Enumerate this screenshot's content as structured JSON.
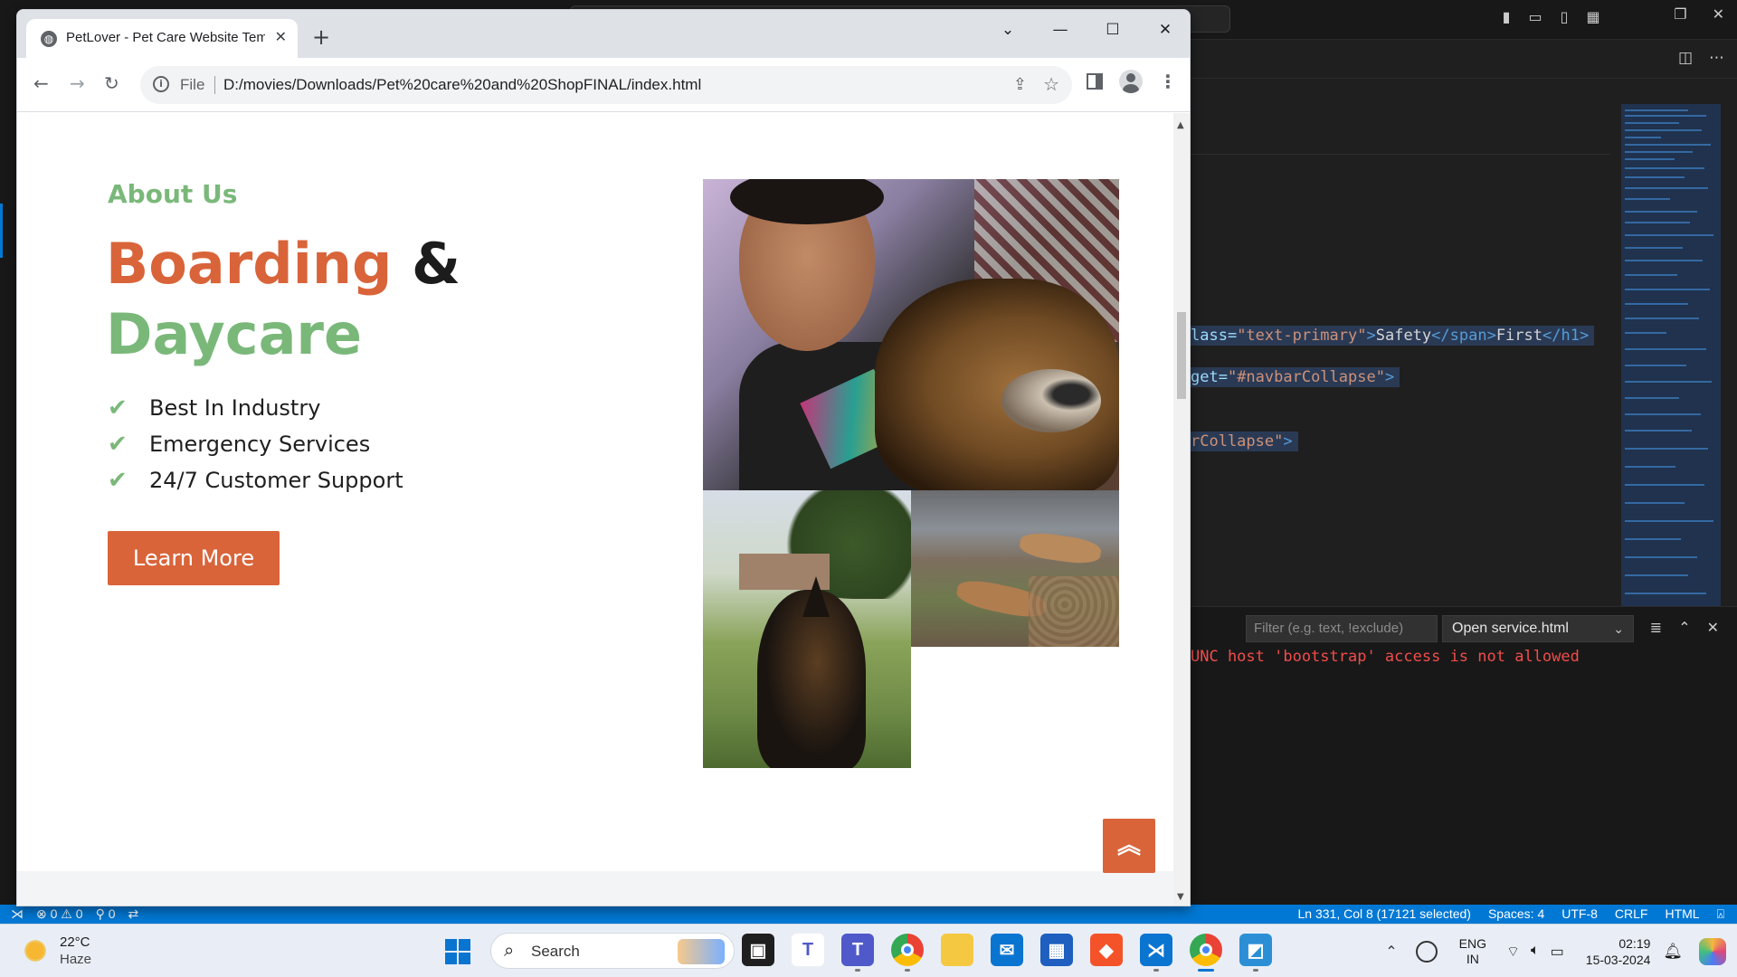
{
  "vscode": {
    "code_lines": [
      {
        "attr": "lass=",
        "value": "\"text-primary\"",
        "gt": ">",
        "text1": "Safety",
        "close_span": "</span>",
        "text2": "First",
        "close_h1": "</h1>",
        "end": ">"
      },
      {
        "attr": "get=",
        "value": "\"#navbarCollapse\"",
        "end": ">"
      },
      {
        "value": "rCollapse\"",
        "end": ">"
      }
    ],
    "output_filter_placeholder": "Filter (e.g. text, !exclude)",
    "output_channel": "Open service.html",
    "output_error": "UNC host 'bootstrap' access is not allowed",
    "statusbar": {
      "errors": "0",
      "warnings": "0",
      "ports": "0",
      "position": "Ln 331, Col 8 (17121 selected)",
      "spaces": "Spaces: 4",
      "encoding": "UTF-8",
      "eol": "CRLF",
      "language": "HTML"
    }
  },
  "browser": {
    "tab_title": "PetLover - Pet Care Website Tem",
    "url_scheme_label": "File",
    "url": "D:/movies/Downloads/Pet%20care%20and%20ShopFINAL/index.html"
  },
  "page": {
    "about_label": "About Us",
    "headline_word1": "Boarding",
    "headline_amp": "&",
    "headline_word2": "Daycare",
    "features": [
      "Best In Industry",
      "Emergency Services",
      "24/7 Customer Support"
    ],
    "cta_label": "Learn More",
    "accent_color": "#d9643a",
    "green_color": "#7ab87a"
  },
  "taskbar": {
    "weather_temp": "22°C",
    "weather_cond": "Haze",
    "search_label": "Search",
    "lang_top": "ENG",
    "lang_bottom": "IN",
    "time": "02:19",
    "date": "15-03-2024"
  }
}
